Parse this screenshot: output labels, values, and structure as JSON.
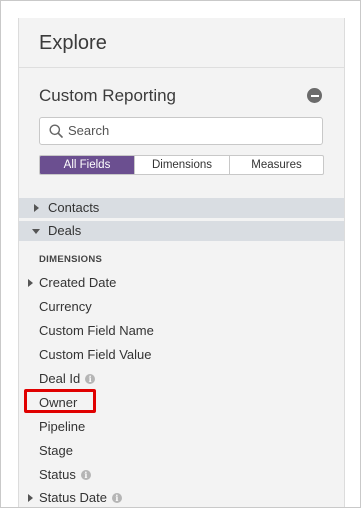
{
  "header": {
    "title": "Explore"
  },
  "section": {
    "title": "Custom Reporting"
  },
  "search": {
    "placeholder": "Search"
  },
  "tabs": [
    {
      "label": "All Fields",
      "active": true
    },
    {
      "label": "Dimensions",
      "active": false
    },
    {
      "label": "Measures",
      "active": false
    }
  ],
  "groups": [
    {
      "label": "Contacts",
      "expanded": false
    },
    {
      "label": "Deals",
      "expanded": true
    }
  ],
  "dimensions": {
    "header": "DIMENSIONS",
    "fields": [
      {
        "label": "Created Date",
        "expandable": true,
        "info": false
      },
      {
        "label": "Currency",
        "expandable": false,
        "info": false
      },
      {
        "label": "Custom Field Name",
        "expandable": false,
        "info": false
      },
      {
        "label": "Custom Field Value",
        "expandable": false,
        "info": false
      },
      {
        "label": "Deal Id",
        "expandable": false,
        "info": true
      },
      {
        "label": "Owner",
        "expandable": false,
        "info": false,
        "highlighted": true
      },
      {
        "label": "Pipeline",
        "expandable": false,
        "info": false
      },
      {
        "label": "Stage",
        "expandable": false,
        "info": false
      },
      {
        "label": "Status",
        "expandable": false,
        "info": true
      },
      {
        "label": "Status Date",
        "expandable": true,
        "info": true
      }
    ]
  },
  "icons": {
    "info": "i"
  },
  "colors": {
    "accent": "#6b4f90",
    "highlight": "#e00000",
    "group_bg": "#d9dde2",
    "panel_bg": "#f3f3f3"
  }
}
